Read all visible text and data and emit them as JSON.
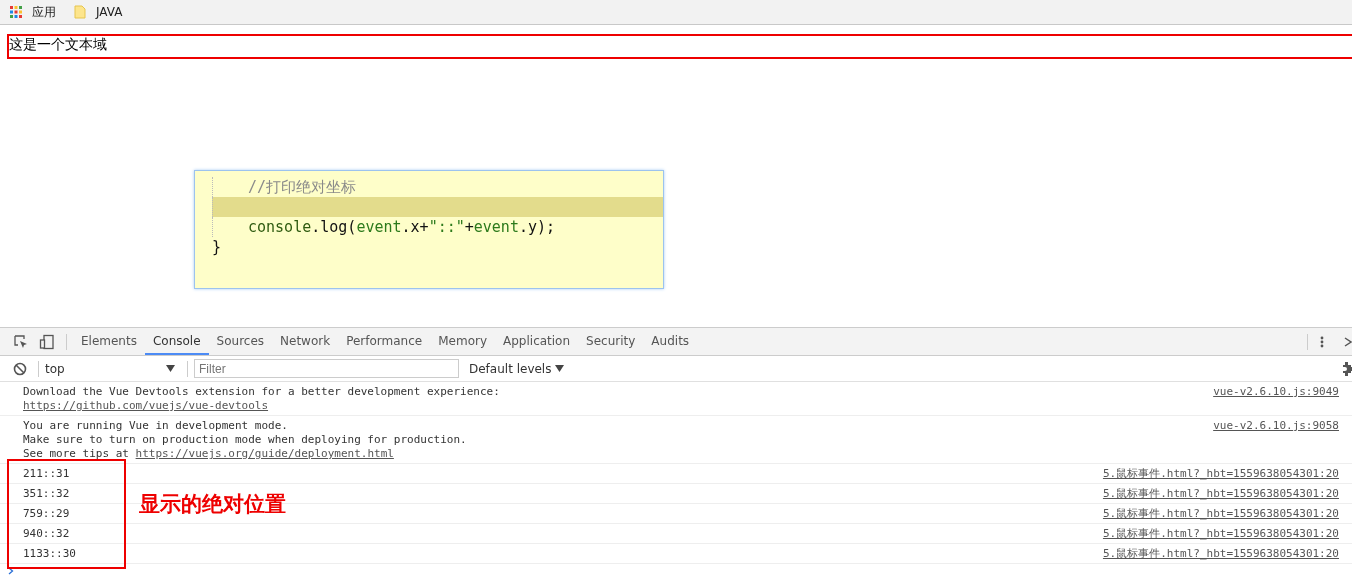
{
  "bookmarks": [
    {
      "kind": "apps",
      "label": "应用"
    },
    {
      "kind": "folder",
      "label": "JAVA"
    }
  ],
  "textarea": {
    "value": "这是一个文本域"
  },
  "code_popup": {
    "lines": [
      {
        "highlighted": false,
        "indent": true,
        "parts": [
          {
            "kind": "comment",
            "text": "//打印绝对坐标"
          }
        ]
      },
      {
        "highlighted": true,
        "indent": true
      },
      {
        "highlighted": false,
        "indent": true,
        "parts": [
          {
            "kind": "ident",
            "text": "console"
          },
          {
            "kind": "plain",
            "text": ".log("
          },
          {
            "kind": "var",
            "text": "event"
          },
          {
            "kind": "plain",
            "text": ".x+"
          },
          {
            "kind": "string",
            "text": "\"::\""
          },
          {
            "kind": "plain",
            "text": "+"
          },
          {
            "kind": "var",
            "text": "event"
          },
          {
            "kind": "plain",
            "text": ".y);"
          }
        ]
      },
      {
        "highlighted": false,
        "indent": false,
        "parts": [
          {
            "kind": "plain",
            "text": "}"
          }
        ]
      }
    ]
  },
  "devtools": {
    "tabs": [
      {
        "label": "Elements",
        "selected": false
      },
      {
        "label": "Console",
        "selected": true
      },
      {
        "label": "Sources",
        "selected": false
      },
      {
        "label": "Network",
        "selected": false
      },
      {
        "label": "Performance",
        "selected": false
      },
      {
        "label": "Memory",
        "selected": false
      },
      {
        "label": "Application",
        "selected": false
      },
      {
        "label": "Security",
        "selected": false
      },
      {
        "label": "Audits",
        "selected": false
      }
    ],
    "context": "top",
    "filter": {
      "placeholder": "Filter"
    },
    "levels": "Default levels",
    "messages": [
      {
        "lines": [
          [
            {
              "kind": "text",
              "text": "Download the Vue Devtools extension for a better development experience:"
            }
          ],
          [
            {
              "kind": "link",
              "text": "https://github.com/vuejs/vue-devtools"
            }
          ]
        ],
        "source": "vue-v2.6.10.js:9049"
      },
      {
        "lines": [
          [
            {
              "kind": "text",
              "text": "You are running Vue in development mode."
            }
          ],
          [
            {
              "kind": "text",
              "text": "Make sure to turn on production mode when deploying for production."
            }
          ],
          [
            {
              "kind": "text",
              "text": "See more tips at "
            },
            {
              "kind": "link",
              "text": "https://vuejs.org/guide/deployment.html"
            }
          ]
        ],
        "source": "vue-v2.6.10.js:9058"
      },
      {
        "lines": [
          [
            {
              "kind": "text",
              "text": "211::31"
            }
          ]
        ],
        "source": "5.鼠标事件.html?_hbt=1559638054301:20"
      },
      {
        "lines": [
          [
            {
              "kind": "text",
              "text": "351::32"
            }
          ]
        ],
        "source": "5.鼠标事件.html?_hbt=1559638054301:20"
      },
      {
        "lines": [
          [
            {
              "kind": "text",
              "text": "759::29"
            }
          ]
        ],
        "source": "5.鼠标事件.html?_hbt=1559638054301:20"
      },
      {
        "lines": [
          [
            {
              "kind": "text",
              "text": "940::32"
            }
          ]
        ],
        "source": "5.鼠标事件.html?_hbt=1559638054301:20"
      },
      {
        "lines": [
          [
            {
              "kind": "text",
              "text": "1133::30"
            }
          ]
        ],
        "source": "5.鼠标事件.html?_hbt=1559638054301:20"
      }
    ]
  },
  "annotation": {
    "text": "显示的绝对位置"
  }
}
